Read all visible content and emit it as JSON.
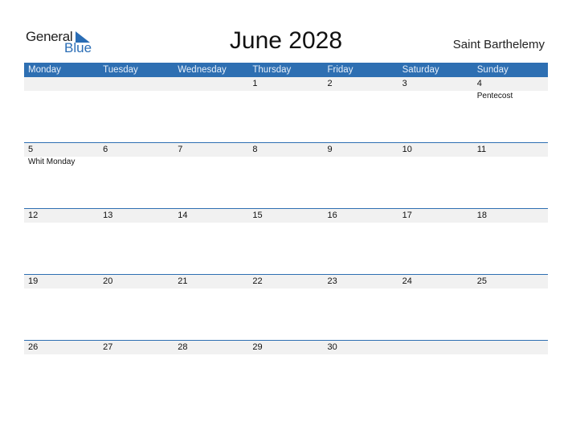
{
  "logo": {
    "word1": "General",
    "word2": "Blue",
    "accent": "#2a6db5"
  },
  "title": "June 2028",
  "country": "Saint Barthelemy",
  "weekdays": [
    "Monday",
    "Tuesday",
    "Wednesday",
    "Thursday",
    "Friday",
    "Saturday",
    "Sunday"
  ],
  "weeks": [
    {
      "days": [
        "",
        "",
        "",
        "1",
        "2",
        "3",
        "4"
      ],
      "events": [
        "",
        "",
        "",
        "",
        "",
        "",
        "Pentecost"
      ]
    },
    {
      "days": [
        "5",
        "6",
        "7",
        "8",
        "9",
        "10",
        "11"
      ],
      "events": [
        "Whit Monday",
        "",
        "",
        "",
        "",
        "",
        ""
      ]
    },
    {
      "days": [
        "12",
        "13",
        "14",
        "15",
        "16",
        "17",
        "18"
      ],
      "events": [
        "",
        "",
        "",
        "",
        "",
        "",
        ""
      ]
    },
    {
      "days": [
        "19",
        "20",
        "21",
        "22",
        "23",
        "24",
        "25"
      ],
      "events": [
        "",
        "",
        "",
        "",
        "",
        "",
        ""
      ]
    },
    {
      "days": [
        "26",
        "27",
        "28",
        "29",
        "30",
        "",
        ""
      ],
      "events": [
        "",
        "",
        "",
        "",
        "",
        "",
        ""
      ]
    }
  ],
  "colors": {
    "header": "#2e6fb2",
    "band": "#f1f1f1"
  }
}
